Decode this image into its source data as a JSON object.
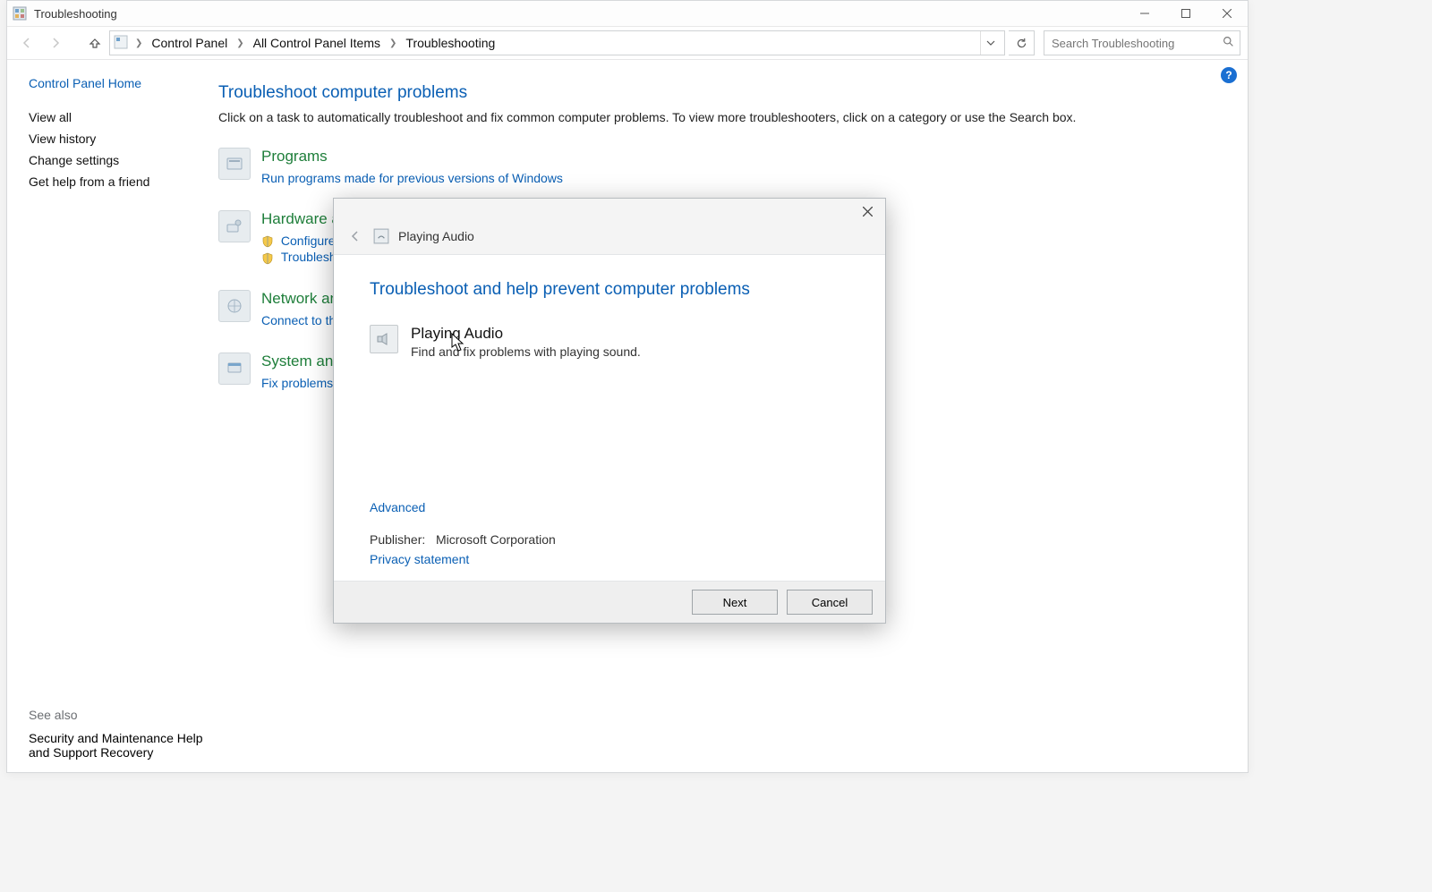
{
  "window": {
    "title": "Troubleshooting"
  },
  "address_bar": {
    "crumbs": [
      "Control Panel",
      "All Control Panel Items",
      "Troubleshooting"
    ]
  },
  "search": {
    "placeholder": "Search Troubleshooting"
  },
  "sidebar": {
    "home_link": "Control Panel Home",
    "links": [
      "View all",
      "View history",
      "Change settings",
      "Get help from a friend"
    ],
    "see_also_title": "See also",
    "see_also": [
      "Security and Maintenance",
      "Help and Support",
      "Recovery"
    ]
  },
  "main": {
    "heading": "Troubleshoot computer problems",
    "subtext": "Click on a task to automatically troubleshoot and fix common computer problems. To view more troubleshooters, click on a category or use the Search box.",
    "categories": [
      {
        "title": "Programs",
        "subs": [
          {
            "label": "Run programs made for previous versions of Windows",
            "shield": false
          }
        ]
      },
      {
        "title": "Hardware and Sound",
        "subs": [
          {
            "label": "Configure a device",
            "shield": true
          },
          {
            "label": "Troubleshoot audio playback",
            "shield": true
          }
        ]
      },
      {
        "title": "Network and Internet",
        "subs": [
          {
            "label": "Connect to the Internet",
            "shield": false
          }
        ]
      },
      {
        "title": "System and Security",
        "subs": [
          {
            "label": "Fix problems with Windows Update",
            "shield": false
          }
        ]
      }
    ]
  },
  "modal": {
    "breadcrumb": "Playing Audio",
    "heading": "Troubleshoot and help prevent computer problems",
    "item_title": "Playing Audio",
    "item_desc": "Find and fix problems with playing sound.",
    "advanced": "Advanced",
    "publisher_label": "Publisher:",
    "publisher_value": "Microsoft Corporation",
    "privacy": "Privacy statement",
    "next": "Next",
    "cancel": "Cancel"
  }
}
